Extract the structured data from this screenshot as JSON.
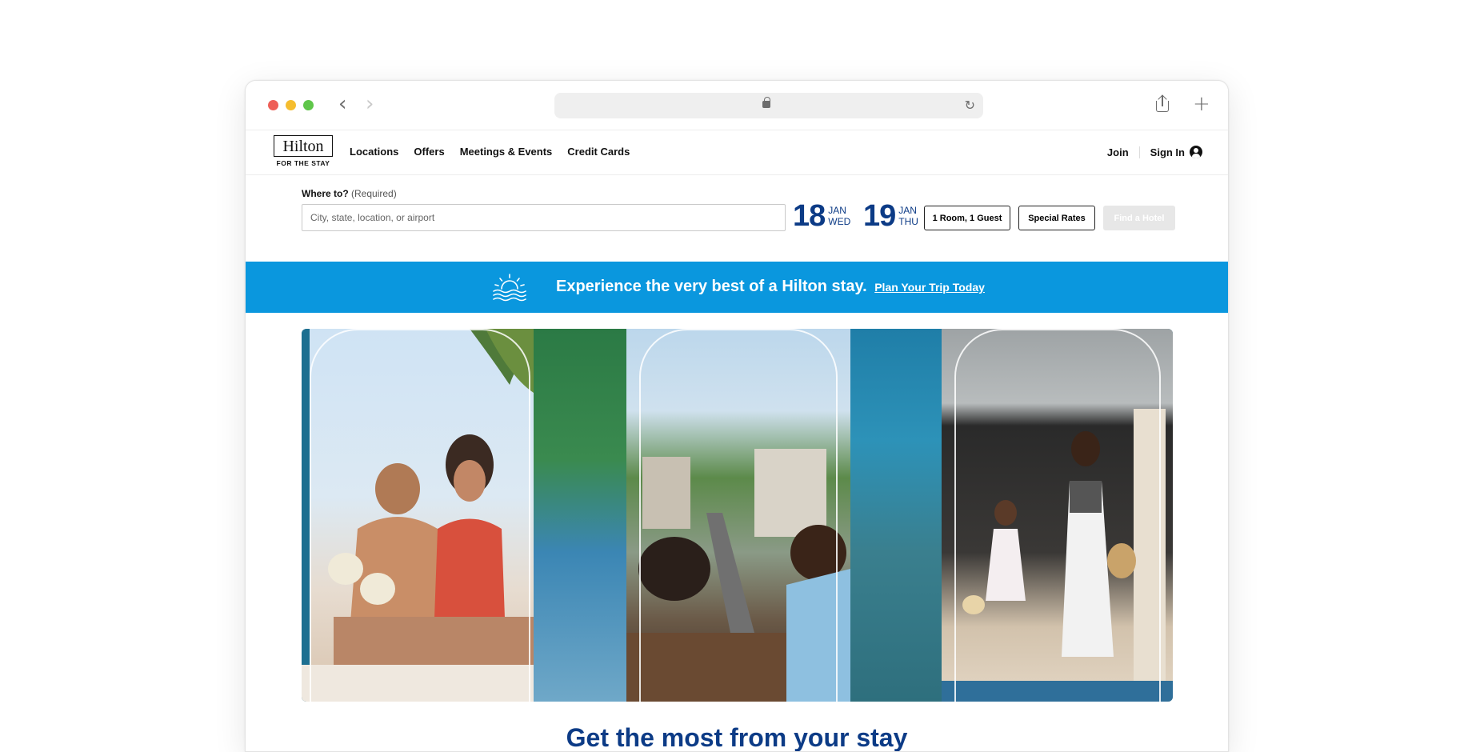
{
  "browser": {
    "url": ""
  },
  "brand": {
    "name": "Hilton",
    "tagline": "FOR THE STAY"
  },
  "nav": {
    "items": [
      {
        "label": "Locations"
      },
      {
        "label": "Offers"
      },
      {
        "label": "Meetings & Events"
      },
      {
        "label": "Credit Cards"
      }
    ],
    "join": "Join",
    "sign_in": "Sign In"
  },
  "search": {
    "label": "Where to?",
    "label_note": "(Required)",
    "placeholder": "City, state, location, or airport",
    "check_in": {
      "day": "18",
      "month": "JAN",
      "weekday": "WED"
    },
    "check_out": {
      "day": "19",
      "month": "JAN",
      "weekday": "THU"
    },
    "rooms_guests": "1 Room, 1 Guest",
    "special_rates": "Special Rates",
    "find_button": "Find a Hotel"
  },
  "promo": {
    "text": "Experience the very best of a Hilton stay.",
    "link": "Plan Your Trip Today"
  },
  "hero": {
    "icon": "sun-over-waves-icon"
  },
  "section": {
    "heading": "Get the most from your stay"
  },
  "colors": {
    "brand_navy": "#0c3b86",
    "promo_blue": "#0a97de"
  }
}
